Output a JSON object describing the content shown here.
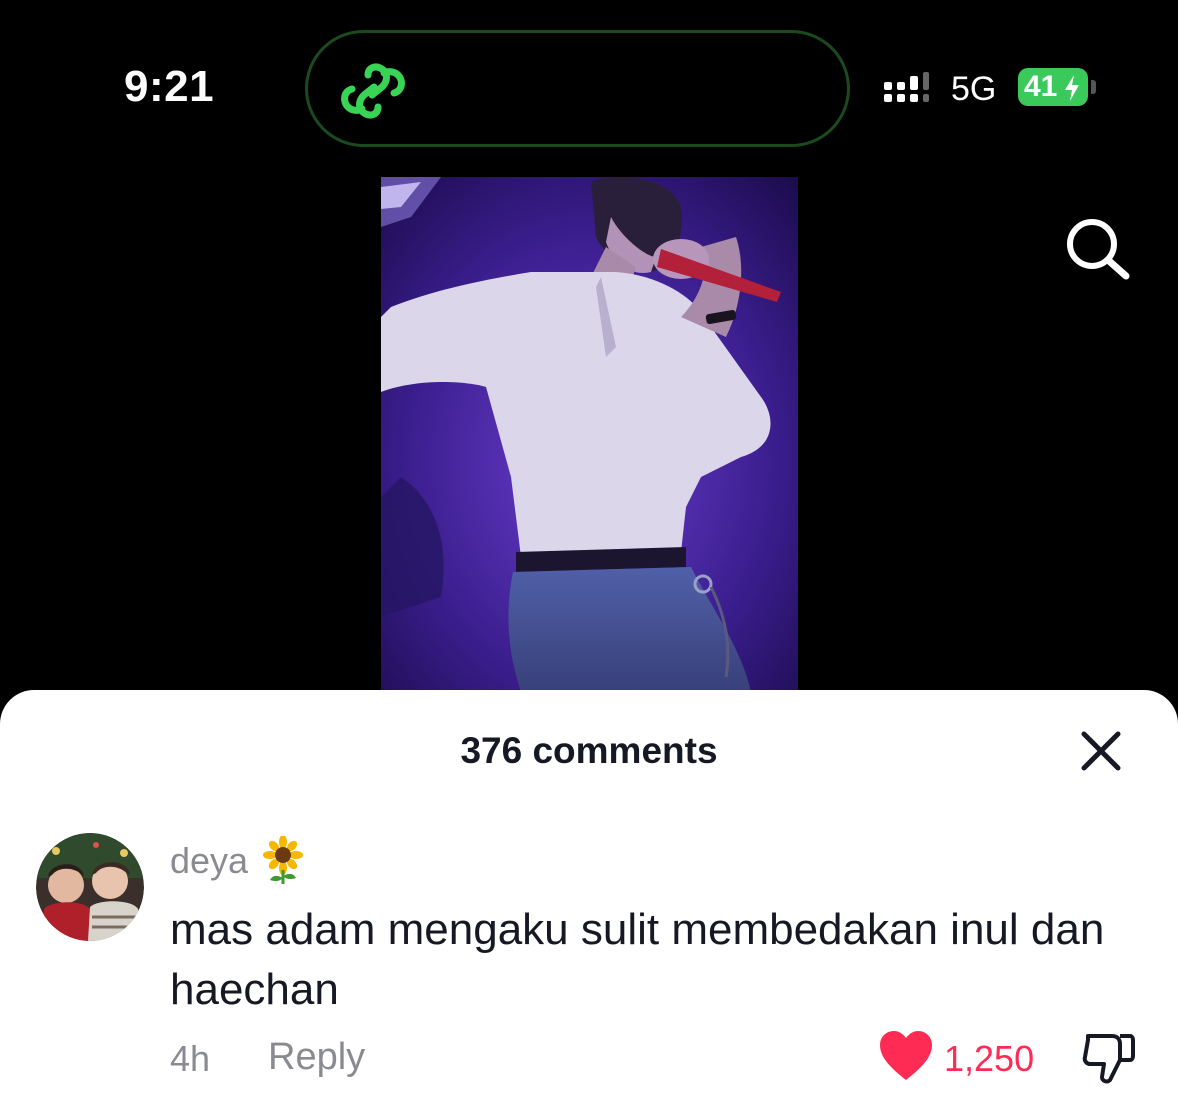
{
  "status_bar": {
    "time": "9:21",
    "network": "5G",
    "battery_level": "41",
    "battery_color": "#3bc95c",
    "island_icon": "chain-link-icon"
  },
  "header": {
    "search_icon": "search-icon"
  },
  "comments_sheet": {
    "title": "376 comments",
    "close_icon": "close-icon",
    "comments": [
      {
        "username": "deya",
        "username_emoji": "sunflower",
        "text": "mas adam mengaku sulit membedakan inul dan haechan",
        "time": "4h",
        "reply_label": "Reply",
        "likes": "1,250",
        "liked": true,
        "like_color": "#fe2c55"
      }
    ]
  }
}
